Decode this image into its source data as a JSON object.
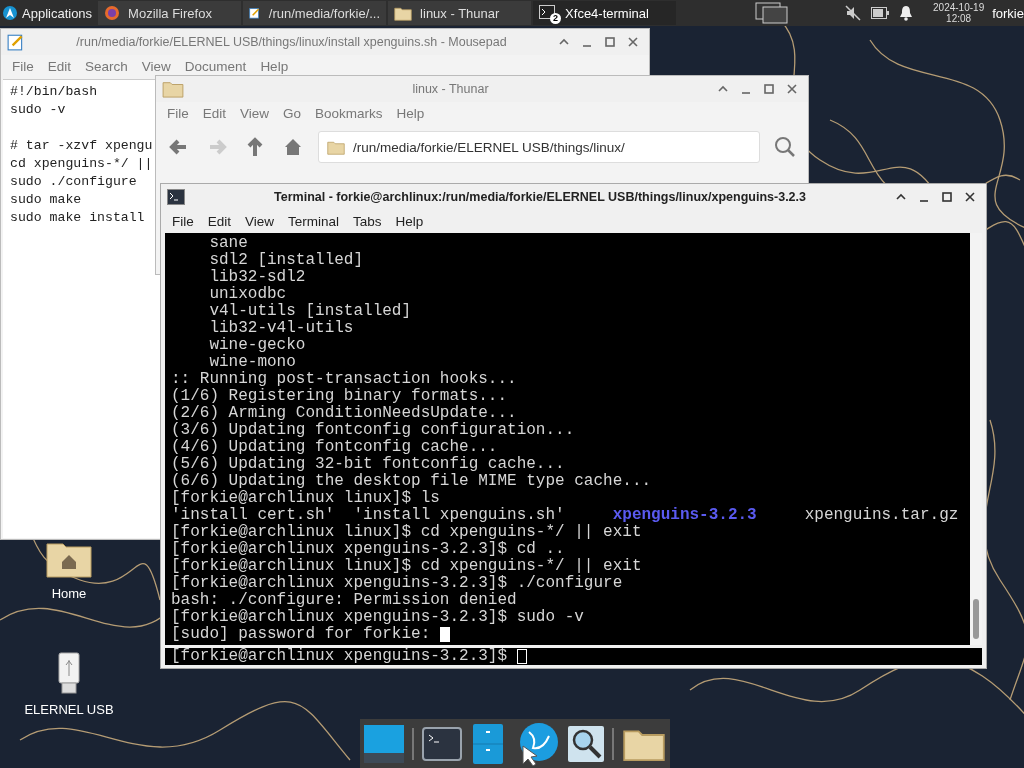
{
  "panel": {
    "apps_menu": "Applications",
    "tasks": [
      {
        "label": "Mozilla Firefox",
        "kind": "browser",
        "selected": false
      },
      {
        "label": "/run/media/forkie/...",
        "kind": "editor",
        "selected": false
      },
      {
        "label": "linux - Thunar",
        "kind": "folder",
        "selected": false
      },
      {
        "label": "Xfce4-terminal",
        "kind": "terminal",
        "badge": "2",
        "selected": true
      }
    ],
    "clock_date": "2024-10-19",
    "clock_time": "12:08",
    "user": "forkie"
  },
  "mousepad": {
    "title": "/run/media/forkie/ELERNEL USB/things/linux/install xpenguins.sh - Mousepad",
    "menu": [
      "File",
      "Edit",
      "Search",
      "View",
      "Document",
      "Help"
    ],
    "text": "#!/bin/bash\nsudo -v\n\n# tar -xzvf xpengu\ncd xpenguins-*/ ||\nsudo ./configure\nsudo make\nsudo make install"
  },
  "thunar": {
    "title": "linux - Thunar",
    "menu": [
      "File",
      "Edit",
      "View",
      "Go",
      "Bookmarks",
      "Help"
    ],
    "address": "/run/media/forkie/ELERNEL USB/things/linux/"
  },
  "terminal": {
    "title": "Terminal - forkie@archlinux:/run/media/forkie/ELERNEL USB/things/linux/xpenguins-3.2.3",
    "menu": [
      "File",
      "Edit",
      "View",
      "Terminal",
      "Tabs",
      "Help"
    ],
    "lines": [
      {
        "text": "    sane"
      },
      {
        "text": "    sdl2 [installed]"
      },
      {
        "text": "    lib32-sdl2"
      },
      {
        "text": "    unixodbc"
      },
      {
        "text": "    v4l-utils [installed]"
      },
      {
        "text": "    lib32-v4l-utils"
      },
      {
        "text": "    wine-gecko"
      },
      {
        "text": "    wine-mono"
      },
      {
        "text": ":: Running post-transaction hooks..."
      },
      {
        "text": "(1/6) Registering binary formats..."
      },
      {
        "text": "(2/6) Arming ConditionNeedsUpdate..."
      },
      {
        "text": "(3/6) Updating fontconfig configuration..."
      },
      {
        "text": "(4/6) Updating fontconfig cache..."
      },
      {
        "text": "(5/6) Updating 32-bit fontconfig cache..."
      },
      {
        "text": "(6/6) Updating the desktop file MIME type cache..."
      },
      {
        "text": "[forkie@archlinux linux]$ ls"
      },
      {
        "segments": [
          {
            "text": "'install cert.sh'  'install xpenguins.sh'",
            "kind": "file"
          },
          {
            "text": "xpenguins-3.2.3",
            "kind": "directory"
          },
          {
            "text": "xpenguins.tar.gz",
            "kind": "file"
          }
        ]
      },
      {
        "text": "[forkie@archlinux linux]$ cd xpenguins-*/ || exit"
      },
      {
        "text": "[forkie@archlinux xpenguins-3.2.3]$ cd .."
      },
      {
        "text": "[forkie@archlinux linux]$ cd xpenguins-*/ || exit"
      },
      {
        "text": "[forkie@archlinux xpenguins-3.2.3]$ ./configure"
      },
      {
        "text": "bash: ./configure: Permission denied"
      },
      {
        "text": "[forkie@archlinux xpenguins-3.2.3]$ sudo -v"
      },
      {
        "text": "[sudo] password for forkie:",
        "cursor": true,
        "cursor_filled": true
      }
    ],
    "bottom_line": {
      "text": "[forkie@archlinux xpenguins-3.2.3]$",
      "cursor": true,
      "cursor_filled": false
    }
  },
  "desktop_icons": [
    {
      "label": "Home",
      "kind": "home"
    },
    {
      "label": "ELERNEL USB",
      "kind": "usb"
    }
  ],
  "dock": [
    {
      "kind": "desktop"
    },
    {
      "kind": "terminal"
    },
    {
      "kind": "cabinet"
    },
    {
      "kind": "browser"
    },
    {
      "kind": "search"
    },
    {
      "kind": "folder"
    }
  ]
}
